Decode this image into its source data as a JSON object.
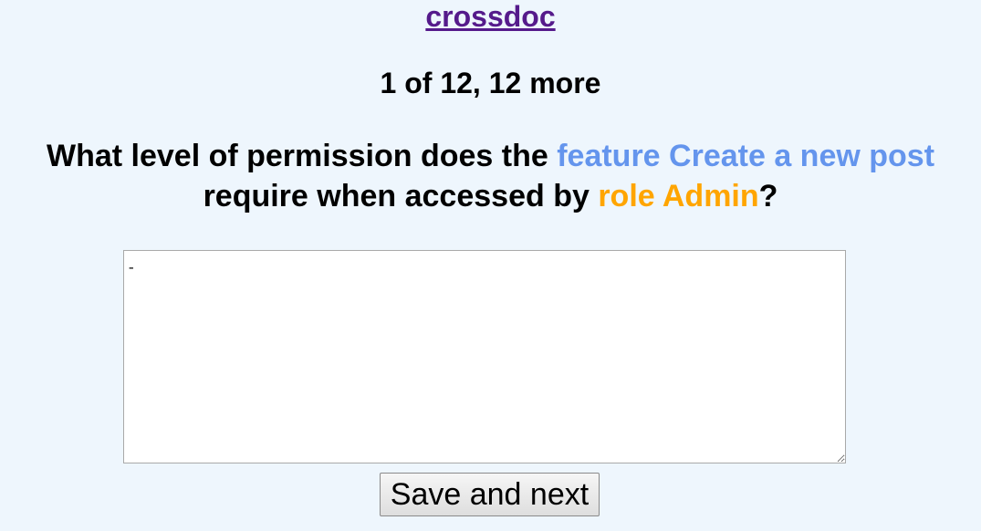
{
  "header": {
    "app_title": "crossdoc"
  },
  "progress": {
    "text": "1 of 12, 12 more"
  },
  "question": {
    "prefix": "What level of permission does the",
    "feature_phrase": "feature Create a new post",
    "middle": "require when accessed by",
    "role_phrase": "role Admin",
    "suffix": "?"
  },
  "answer": {
    "value": "-",
    "placeholder": ""
  },
  "actions": {
    "save_next_label": "Save and next"
  },
  "colors": {
    "background": "#eef6fd",
    "link_visited": "#551a8b",
    "feature_highlight": "#6495ed",
    "role_highlight": "#ffa500"
  }
}
